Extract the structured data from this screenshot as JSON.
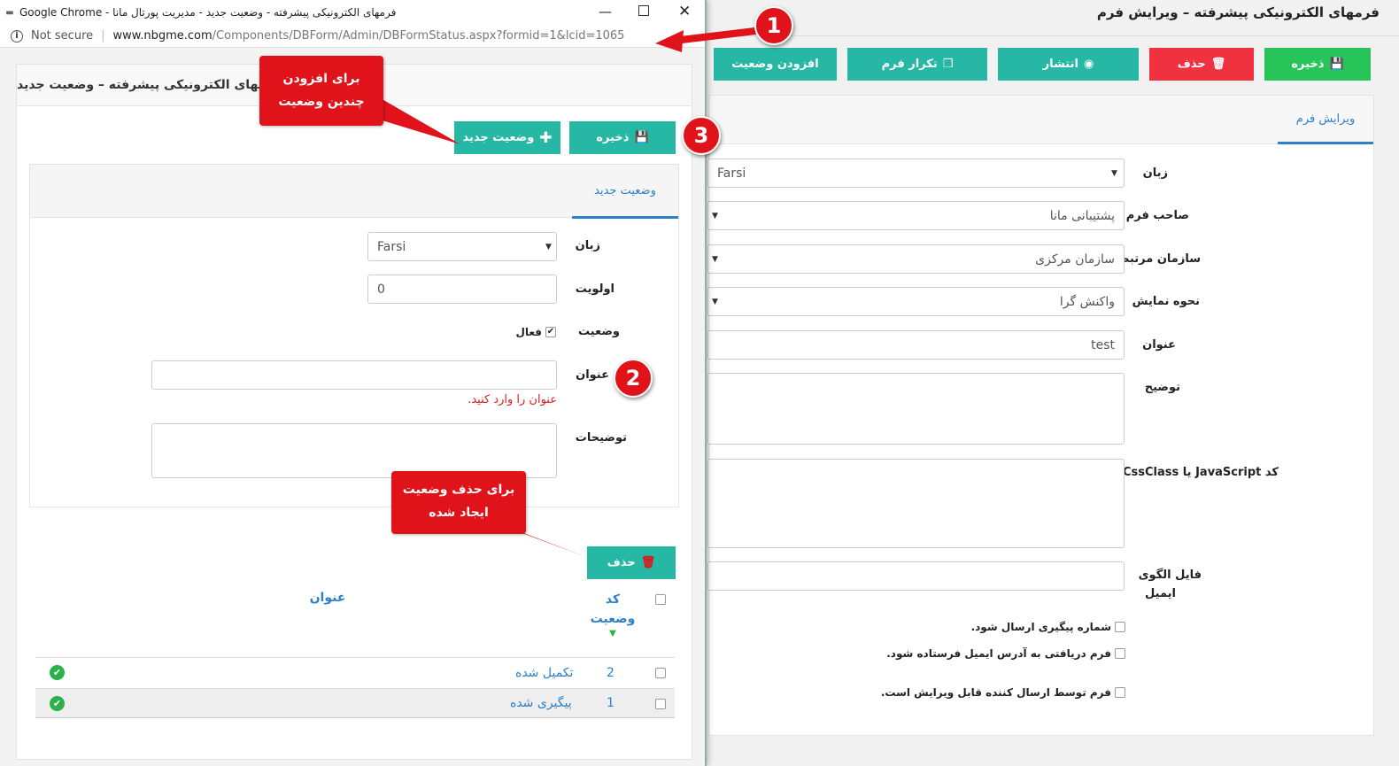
{
  "background": {
    "title": "فرمهای الکترونیکی پیشرفته – ویرایش فرم",
    "toolbar": {
      "save": "ذخیره",
      "delete": "حذف",
      "publish": "انتشار",
      "duplicate": "تکرار فرم",
      "add_status": "افزودن وضعیت"
    },
    "tab": "ویرایش فرم",
    "fields": {
      "language_label": "زبان",
      "language_value": "Farsi",
      "owner_label": "صاحب فرم",
      "owner_value": "پشتیبانی مانا",
      "org_label": "سازمان مرتبط",
      "org_value": "سازمان مرکزی",
      "display_label": "نحوه نمایش",
      "display_value": "واکنش گرا",
      "title_label": "عنوان",
      "title_value": "test",
      "desc_label": "توضیح",
      "code_label": "کد JavaScript یا CssClass",
      "email_label_1": "فایل الگوی",
      "email_label_2": "ایمیل"
    },
    "checkboxes": [
      "شماره پیگیری ارسال شود.",
      "فرم دریافتی به آدرس ایمیل فرستاده شود.",
      "فرم توسط ارسال کننده قابل ویرایش است."
    ]
  },
  "popup": {
    "window_title": "فرمهای الکترونیکی پیشرفته - وضعیت جدید - مدیریت پورتال مانا - Google Chrome",
    "not_secure": "Not secure",
    "url_host": "www.nbgme.com",
    "url_path": "/Components/DBForm/Admin/DBFormStatus.aspx?formid=1&lcid=1065",
    "heading": "فرمهای الکترونیکی پیشرفته – وضعیت جدید",
    "save": "ذخیره",
    "new_status": "وضعیت جدید",
    "tab": "وضعیت جدید",
    "language_label": "زبان",
    "language_value": "Farsi",
    "priority_label": "اولویت",
    "priority_value": "0",
    "status_label": "وضعیت",
    "active_label": "فعال",
    "title_label": "عنوان",
    "title_error": "عنوان را وارد کنید.",
    "desc_label": "توضیحات",
    "delete": "حذف",
    "grid": {
      "col_code_1": "کد",
      "col_code_2": "وضعیت",
      "col_title": "عنوان",
      "rows": [
        {
          "code": "2",
          "title": "تکمیل شده"
        },
        {
          "code": "1",
          "title": "پیگیری شده"
        }
      ]
    }
  },
  "callouts": {
    "add_1": "برای افزودن",
    "add_2": "چندین وضعیت",
    "del_1": "برای حذف وضعیت",
    "del_2": "ایجاد شده",
    "badge1": "1",
    "badge2": "2",
    "badge3": "3"
  },
  "colors": {
    "teal": "#26b8a4",
    "red": "#f0313f",
    "green": "#27c45a",
    "link_blue": "#2d80c7",
    "callout_red": "#e0131b"
  }
}
